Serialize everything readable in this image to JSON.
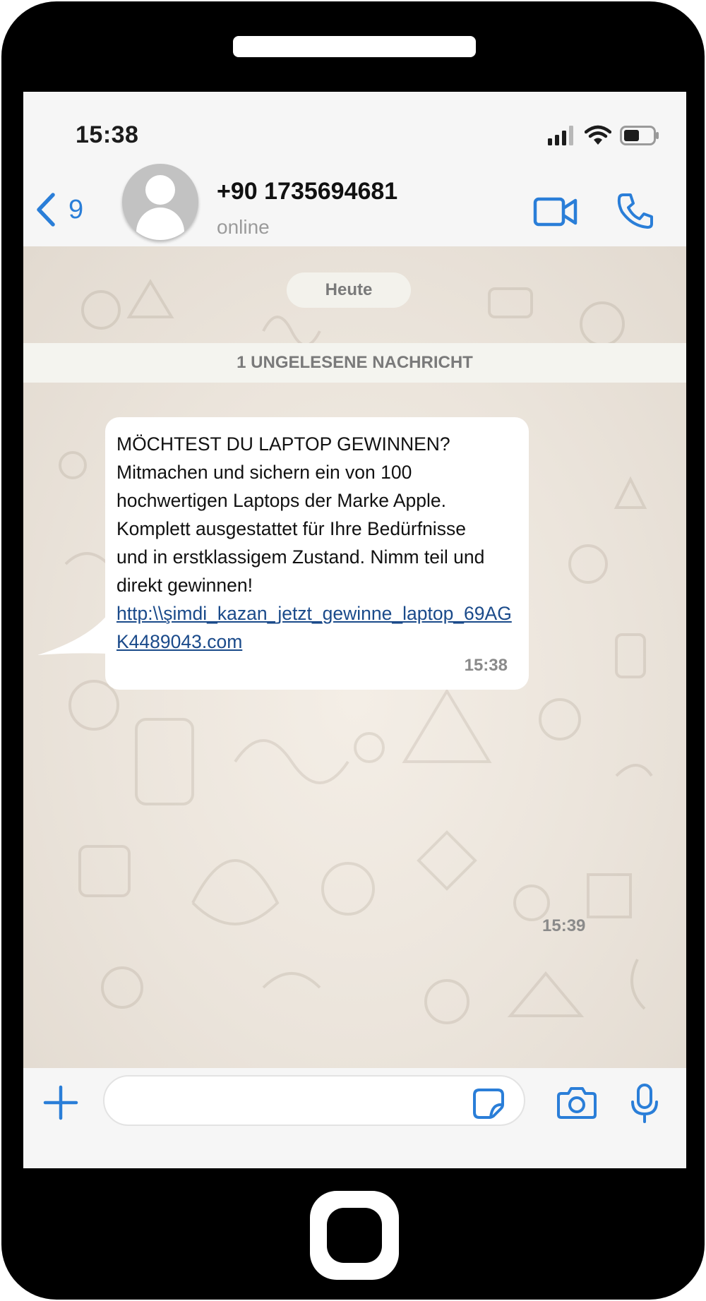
{
  "status_bar": {
    "time": "15:38"
  },
  "header": {
    "back_count": "9",
    "contact_name": "+90 1735694681",
    "contact_status": "online"
  },
  "chat": {
    "date_label": "Heute",
    "unread_label": "1 UNGELESENE NACHRICHT",
    "message": {
      "lines": [
        "MÖCHTEST DU LAPTOP GEWINNEN?",
        "Mitmachen und sichern ein von 100",
        "hochwertigen Laptops der Marke Apple.",
        "Komplett ausgestattet für Ihre Bedürfnisse",
        "und in erstklassigem Zustand. Nimm teil und",
        "direkt gewinnen!"
      ],
      "link": "http:\\\\şimdi_kazan_jetzt_gewinne_laptop_69AGK4489043.com",
      "time": "15:38"
    },
    "loose_time": "15:39"
  },
  "input": {
    "placeholder": ""
  },
  "colors": {
    "ios_blue": "#2a7ed8",
    "chat_bg": "#ede6dd",
    "link": "#1a4a8a"
  }
}
